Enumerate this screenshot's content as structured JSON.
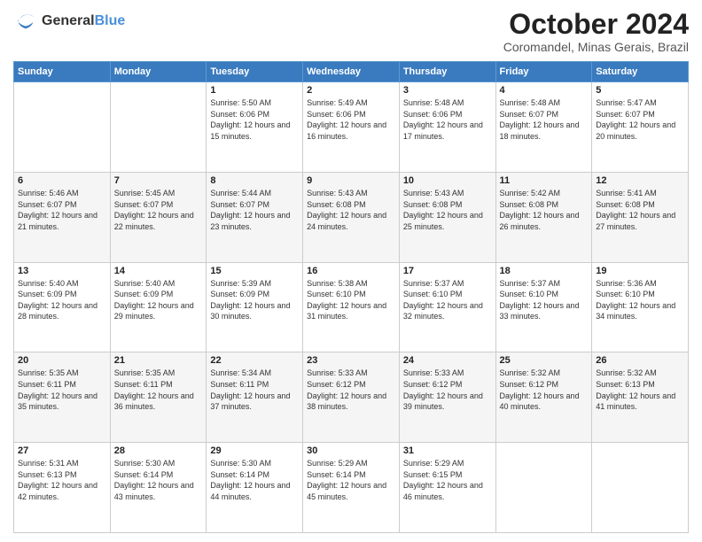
{
  "logo": {
    "general": "General",
    "blue": "Blue"
  },
  "title": "October 2024",
  "location": "Coromandel, Minas Gerais, Brazil",
  "days_of_week": [
    "Sunday",
    "Monday",
    "Tuesday",
    "Wednesday",
    "Thursday",
    "Friday",
    "Saturday"
  ],
  "weeks": [
    [
      {
        "day": "",
        "sunrise": "",
        "sunset": "",
        "daylight": ""
      },
      {
        "day": "",
        "sunrise": "",
        "sunset": "",
        "daylight": ""
      },
      {
        "day": "1",
        "sunrise": "Sunrise: 5:50 AM",
        "sunset": "Sunset: 6:06 PM",
        "daylight": "Daylight: 12 hours and 15 minutes."
      },
      {
        "day": "2",
        "sunrise": "Sunrise: 5:49 AM",
        "sunset": "Sunset: 6:06 PM",
        "daylight": "Daylight: 12 hours and 16 minutes."
      },
      {
        "day": "3",
        "sunrise": "Sunrise: 5:48 AM",
        "sunset": "Sunset: 6:06 PM",
        "daylight": "Daylight: 12 hours and 17 minutes."
      },
      {
        "day": "4",
        "sunrise": "Sunrise: 5:48 AM",
        "sunset": "Sunset: 6:07 PM",
        "daylight": "Daylight: 12 hours and 18 minutes."
      },
      {
        "day": "5",
        "sunrise": "Sunrise: 5:47 AM",
        "sunset": "Sunset: 6:07 PM",
        "daylight": "Daylight: 12 hours and 20 minutes."
      }
    ],
    [
      {
        "day": "6",
        "sunrise": "Sunrise: 5:46 AM",
        "sunset": "Sunset: 6:07 PM",
        "daylight": "Daylight: 12 hours and 21 minutes."
      },
      {
        "day": "7",
        "sunrise": "Sunrise: 5:45 AM",
        "sunset": "Sunset: 6:07 PM",
        "daylight": "Daylight: 12 hours and 22 minutes."
      },
      {
        "day": "8",
        "sunrise": "Sunrise: 5:44 AM",
        "sunset": "Sunset: 6:07 PM",
        "daylight": "Daylight: 12 hours and 23 minutes."
      },
      {
        "day": "9",
        "sunrise": "Sunrise: 5:43 AM",
        "sunset": "Sunset: 6:08 PM",
        "daylight": "Daylight: 12 hours and 24 minutes."
      },
      {
        "day": "10",
        "sunrise": "Sunrise: 5:43 AM",
        "sunset": "Sunset: 6:08 PM",
        "daylight": "Daylight: 12 hours and 25 minutes."
      },
      {
        "day": "11",
        "sunrise": "Sunrise: 5:42 AM",
        "sunset": "Sunset: 6:08 PM",
        "daylight": "Daylight: 12 hours and 26 minutes."
      },
      {
        "day": "12",
        "sunrise": "Sunrise: 5:41 AM",
        "sunset": "Sunset: 6:08 PM",
        "daylight": "Daylight: 12 hours and 27 minutes."
      }
    ],
    [
      {
        "day": "13",
        "sunrise": "Sunrise: 5:40 AM",
        "sunset": "Sunset: 6:09 PM",
        "daylight": "Daylight: 12 hours and 28 minutes."
      },
      {
        "day": "14",
        "sunrise": "Sunrise: 5:40 AM",
        "sunset": "Sunset: 6:09 PM",
        "daylight": "Daylight: 12 hours and 29 minutes."
      },
      {
        "day": "15",
        "sunrise": "Sunrise: 5:39 AM",
        "sunset": "Sunset: 6:09 PM",
        "daylight": "Daylight: 12 hours and 30 minutes."
      },
      {
        "day": "16",
        "sunrise": "Sunrise: 5:38 AM",
        "sunset": "Sunset: 6:10 PM",
        "daylight": "Daylight: 12 hours and 31 minutes."
      },
      {
        "day": "17",
        "sunrise": "Sunrise: 5:37 AM",
        "sunset": "Sunset: 6:10 PM",
        "daylight": "Daylight: 12 hours and 32 minutes."
      },
      {
        "day": "18",
        "sunrise": "Sunrise: 5:37 AM",
        "sunset": "Sunset: 6:10 PM",
        "daylight": "Daylight: 12 hours and 33 minutes."
      },
      {
        "day": "19",
        "sunrise": "Sunrise: 5:36 AM",
        "sunset": "Sunset: 6:10 PM",
        "daylight": "Daylight: 12 hours and 34 minutes."
      }
    ],
    [
      {
        "day": "20",
        "sunrise": "Sunrise: 5:35 AM",
        "sunset": "Sunset: 6:11 PM",
        "daylight": "Daylight: 12 hours and 35 minutes."
      },
      {
        "day": "21",
        "sunrise": "Sunrise: 5:35 AM",
        "sunset": "Sunset: 6:11 PM",
        "daylight": "Daylight: 12 hours and 36 minutes."
      },
      {
        "day": "22",
        "sunrise": "Sunrise: 5:34 AM",
        "sunset": "Sunset: 6:11 PM",
        "daylight": "Daylight: 12 hours and 37 minutes."
      },
      {
        "day": "23",
        "sunrise": "Sunrise: 5:33 AM",
        "sunset": "Sunset: 6:12 PM",
        "daylight": "Daylight: 12 hours and 38 minutes."
      },
      {
        "day": "24",
        "sunrise": "Sunrise: 5:33 AM",
        "sunset": "Sunset: 6:12 PM",
        "daylight": "Daylight: 12 hours and 39 minutes."
      },
      {
        "day": "25",
        "sunrise": "Sunrise: 5:32 AM",
        "sunset": "Sunset: 6:12 PM",
        "daylight": "Daylight: 12 hours and 40 minutes."
      },
      {
        "day": "26",
        "sunrise": "Sunrise: 5:32 AM",
        "sunset": "Sunset: 6:13 PM",
        "daylight": "Daylight: 12 hours and 41 minutes."
      }
    ],
    [
      {
        "day": "27",
        "sunrise": "Sunrise: 5:31 AM",
        "sunset": "Sunset: 6:13 PM",
        "daylight": "Daylight: 12 hours and 42 minutes."
      },
      {
        "day": "28",
        "sunrise": "Sunrise: 5:30 AM",
        "sunset": "Sunset: 6:14 PM",
        "daylight": "Daylight: 12 hours and 43 minutes."
      },
      {
        "day": "29",
        "sunrise": "Sunrise: 5:30 AM",
        "sunset": "Sunset: 6:14 PM",
        "daylight": "Daylight: 12 hours and 44 minutes."
      },
      {
        "day": "30",
        "sunrise": "Sunrise: 5:29 AM",
        "sunset": "Sunset: 6:14 PM",
        "daylight": "Daylight: 12 hours and 45 minutes."
      },
      {
        "day": "31",
        "sunrise": "Sunrise: 5:29 AM",
        "sunset": "Sunset: 6:15 PM",
        "daylight": "Daylight: 12 hours and 46 minutes."
      },
      {
        "day": "",
        "sunrise": "",
        "sunset": "",
        "daylight": ""
      },
      {
        "day": "",
        "sunrise": "",
        "sunset": "",
        "daylight": ""
      }
    ]
  ]
}
